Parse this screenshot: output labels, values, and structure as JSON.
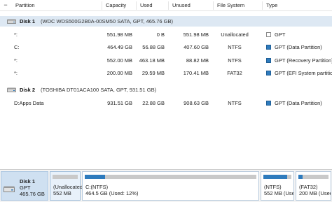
{
  "header": {
    "partition": "Partition",
    "capacity": "Capacity",
    "used": "Used",
    "unused": "Unused",
    "filesystem": "File System",
    "type": "Type"
  },
  "disks": [
    {
      "name": "Disk 1",
      "detail": "(WDC WDS500G2B0A-00SM50 SATA, GPT, 465.76 GB)",
      "partitions": [
        {
          "partition": "*:",
          "capacity": "551.98 MB",
          "used": "0 B",
          "unused": "551.98 MB",
          "filesystem": "Unallocated",
          "type": "GPT",
          "type_icon": "gray-square-icon"
        },
        {
          "partition": "C:",
          "capacity": "464.49 GB",
          "used": "56.88 GB",
          "unused": "407.60 GB",
          "filesystem": "NTFS",
          "type": "GPT (Data Partition)",
          "type_icon": "blue-square-icon"
        },
        {
          "partition": "*:",
          "capacity": "552.00 MB",
          "used": "463.18 MB",
          "unused": "88.82 MB",
          "filesystem": "NTFS",
          "type": "GPT (Recovery Partition)",
          "type_icon": "blue-square-icon"
        },
        {
          "partition": "*:",
          "capacity": "200.00 MB",
          "used": "29.59 MB",
          "unused": "170.41 MB",
          "filesystem": "FAT32",
          "type": "GPT (EFI System partition)",
          "type_icon": "blue-square-icon"
        }
      ]
    },
    {
      "name": "Disk 2",
      "detail": "(TOSHIBA DT01ACA100 SATA, GPT, 931.51 GB)",
      "partitions": [
        {
          "partition": "D:Apps Data",
          "capacity": "931.51 GB",
          "used": "22.88 GB",
          "unused": "908.63 GB",
          "filesystem": "NTFS",
          "type": "GPT (Data Partition)",
          "type_icon": "blue-square-icon"
        }
      ]
    }
  ],
  "disk_map": {
    "disk_name": "Disk 1",
    "disk_type": "GPT",
    "disk_size": "465.76 GB",
    "segments": [
      {
        "label": "(Unallocated)",
        "sub": "552 MB",
        "fill": 0
      },
      {
        "label": "C:(NTFS)",
        "sub": "464.5 GB (Used: 12%)",
        "fill": 0.12
      },
      {
        "label": "(NTFS)",
        "sub": "552 MB (Used:",
        "fill": 0.84
      },
      {
        "label": "(FAT32)",
        "sub": "200 MB (Used",
        "fill": 0.15
      }
    ]
  },
  "colors": {
    "accent": "#2e7bbd",
    "selected_row": "#dde8f3",
    "map_disk": "#cfe0f1"
  }
}
